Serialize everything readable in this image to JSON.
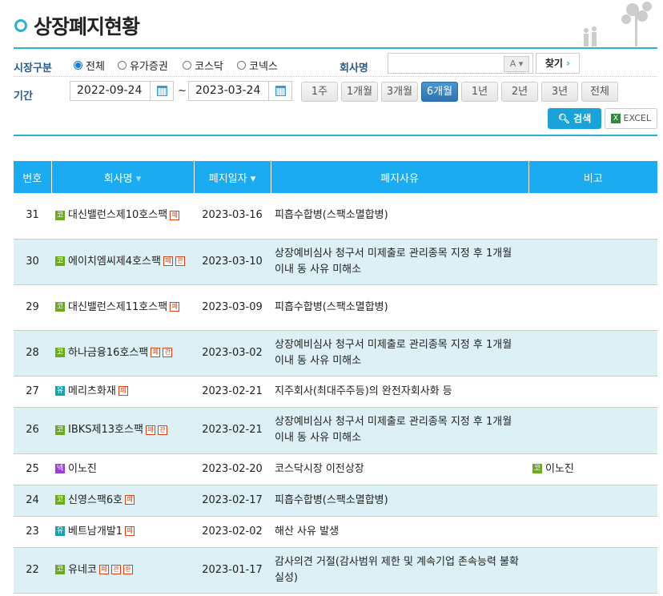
{
  "title": "상장폐지현황",
  "filters": {
    "market_label": "시장구분",
    "markets": [
      "전체",
      "유가증권",
      "코스닥",
      "코넥스"
    ],
    "selected_market": "전체",
    "company_label": "회사명",
    "company_value": "",
    "company_ime": "A",
    "find_button": "찾기",
    "period_label": "기간",
    "start_date": "2022-09-24",
    "end_date": "2023-03-24",
    "tilde": "~",
    "periods": [
      "1주",
      "1개월",
      "3개월",
      "6개월",
      "1년",
      "2년",
      "3년",
      "전체"
    ],
    "selected_period": "6개월",
    "search_button": "검색",
    "excel_button": "EXCEL"
  },
  "table": {
    "headers": [
      "번호",
      "회사명",
      "폐지일자",
      "폐지사유",
      "비고"
    ],
    "rows": [
      {
        "no": "31",
        "market": "코",
        "company": "대신밸런스제10호스팩",
        "tags": [
          "폐"
        ],
        "date": "2023-03-16",
        "reason": "피흡수합병(스팩소멸합병)",
        "note": "",
        "note_market": ""
      },
      {
        "no": "30",
        "market": "코",
        "company": "에이치엠씨제4호스팩",
        "tags": [
          "폐",
          "관"
        ],
        "date": "2023-03-10",
        "reason": "상장예비심사 청구서 미제출로 관리종목 지정 후 1개월 이내 동 사유 미해소",
        "note": "",
        "note_market": ""
      },
      {
        "no": "29",
        "market": "코",
        "company": "대신밸런스제11호스팩",
        "tags": [
          "폐"
        ],
        "date": "2023-03-09",
        "reason": "피흡수합병(스팩소멸합병)",
        "note": "",
        "note_market": ""
      },
      {
        "no": "28",
        "market": "코",
        "company": "하나금융16호스팩",
        "tags": [
          "폐",
          "관"
        ],
        "date": "2023-03-02",
        "reason": "상장예비심사 청구서 미제출로 관리종목 지정 후 1개월 이내 동 사유 미해소",
        "note": "",
        "note_market": ""
      },
      {
        "no": "27",
        "market": "유",
        "company": "메리츠화재",
        "tags": [
          "폐"
        ],
        "date": "2023-02-21",
        "reason": "지주회사(최대주주등)의 완전자회사화 등",
        "note": "",
        "note_market": ""
      },
      {
        "no": "26",
        "market": "코",
        "company": "IBKS제13호스팩",
        "tags": [
          "폐",
          "관"
        ],
        "date": "2023-02-21",
        "reason": "상장예비심사 청구서 미제출로 관리종목 지정 후 1개월 이내 동 사유 미해소",
        "note": "",
        "note_market": ""
      },
      {
        "no": "25",
        "market": "넥",
        "company": "이노진",
        "tags": [],
        "date": "2023-02-20",
        "reason": "코스닥시장 이전상장",
        "note": "이노진",
        "note_market": "코"
      },
      {
        "no": "24",
        "market": "코",
        "company": "신영스팩6호",
        "tags": [
          "폐"
        ],
        "date": "2023-02-17",
        "reason": "피흡수합병(스팩소멸합병)",
        "note": "",
        "note_market": ""
      },
      {
        "no": "23",
        "market": "유",
        "company": "베트남개발1",
        "tags": [
          "폐"
        ],
        "date": "2023-02-02",
        "reason": "해산 사유 발생",
        "note": "",
        "note_market": ""
      },
      {
        "no": "22",
        "market": "코",
        "company": "유네코",
        "tags": [
          "폐",
          "관",
          "환"
        ],
        "date": "2023-01-17",
        "reason": "감사의견 거절(감사범위 제한 및 계속기업 존속능력 불확실성)",
        "note": "",
        "note_market": ""
      }
    ]
  },
  "colors": {
    "accent": "#28b4d0",
    "header": "#1aabf0",
    "alt_row": "#dcf0f6"
  }
}
